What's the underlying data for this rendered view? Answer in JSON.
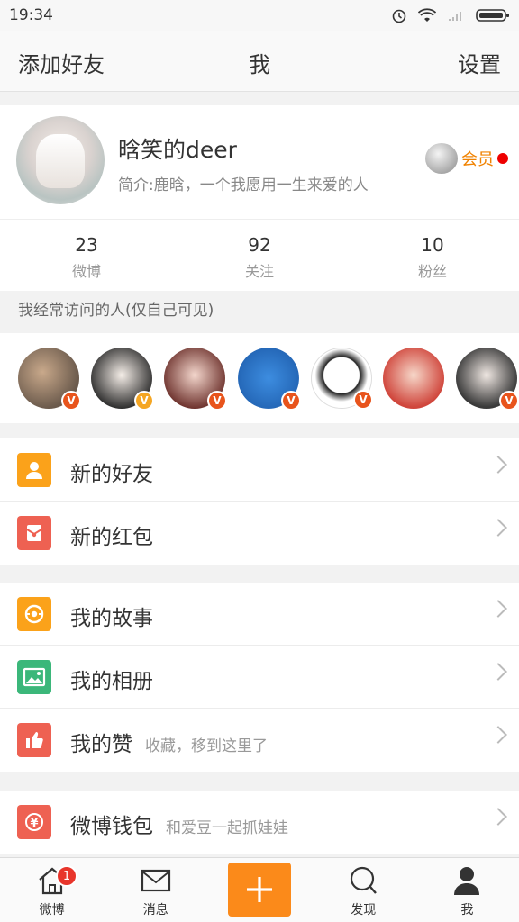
{
  "status": {
    "time": "19:34"
  },
  "header": {
    "left": "添加好友",
    "title": "我",
    "right": "设置"
  },
  "profile": {
    "name": "晗笑的deer",
    "bio": "简介:鹿晗，一个我愿用一生来爱的人",
    "vip_label": "会员",
    "stats": [
      {
        "num": "23",
        "label": "微博"
      },
      {
        "num": "92",
        "label": "关注"
      },
      {
        "num": "10",
        "label": "粉丝"
      }
    ]
  },
  "frequent": {
    "title": "我经常访问的人(仅自己可见)",
    "verified_mark": "V"
  },
  "menu": {
    "group1": [
      {
        "label": "新的好友",
        "icon": "person-icon"
      },
      {
        "label": "新的红包",
        "icon": "red-envelope-icon"
      }
    ],
    "group2": [
      {
        "label": "我的故事",
        "icon": "story-icon"
      },
      {
        "label": "我的相册",
        "icon": "album-icon"
      },
      {
        "label": "我的赞",
        "sub": "收藏，移到这里了",
        "icon": "thumbs-up-icon"
      }
    ],
    "group3": [
      {
        "label": "微博钱包",
        "sub": "和爱豆一起抓娃娃",
        "icon": "wallet-icon"
      }
    ]
  },
  "tabbar": {
    "tabs": [
      {
        "label": "微博",
        "badge": "1"
      },
      {
        "label": "消息"
      },
      {
        "label": "发现"
      },
      {
        "label": "我"
      }
    ]
  },
  "colors": {
    "accent": "#fb8a1a",
    "vip": "#f08200",
    "badge": "#e8352b"
  }
}
